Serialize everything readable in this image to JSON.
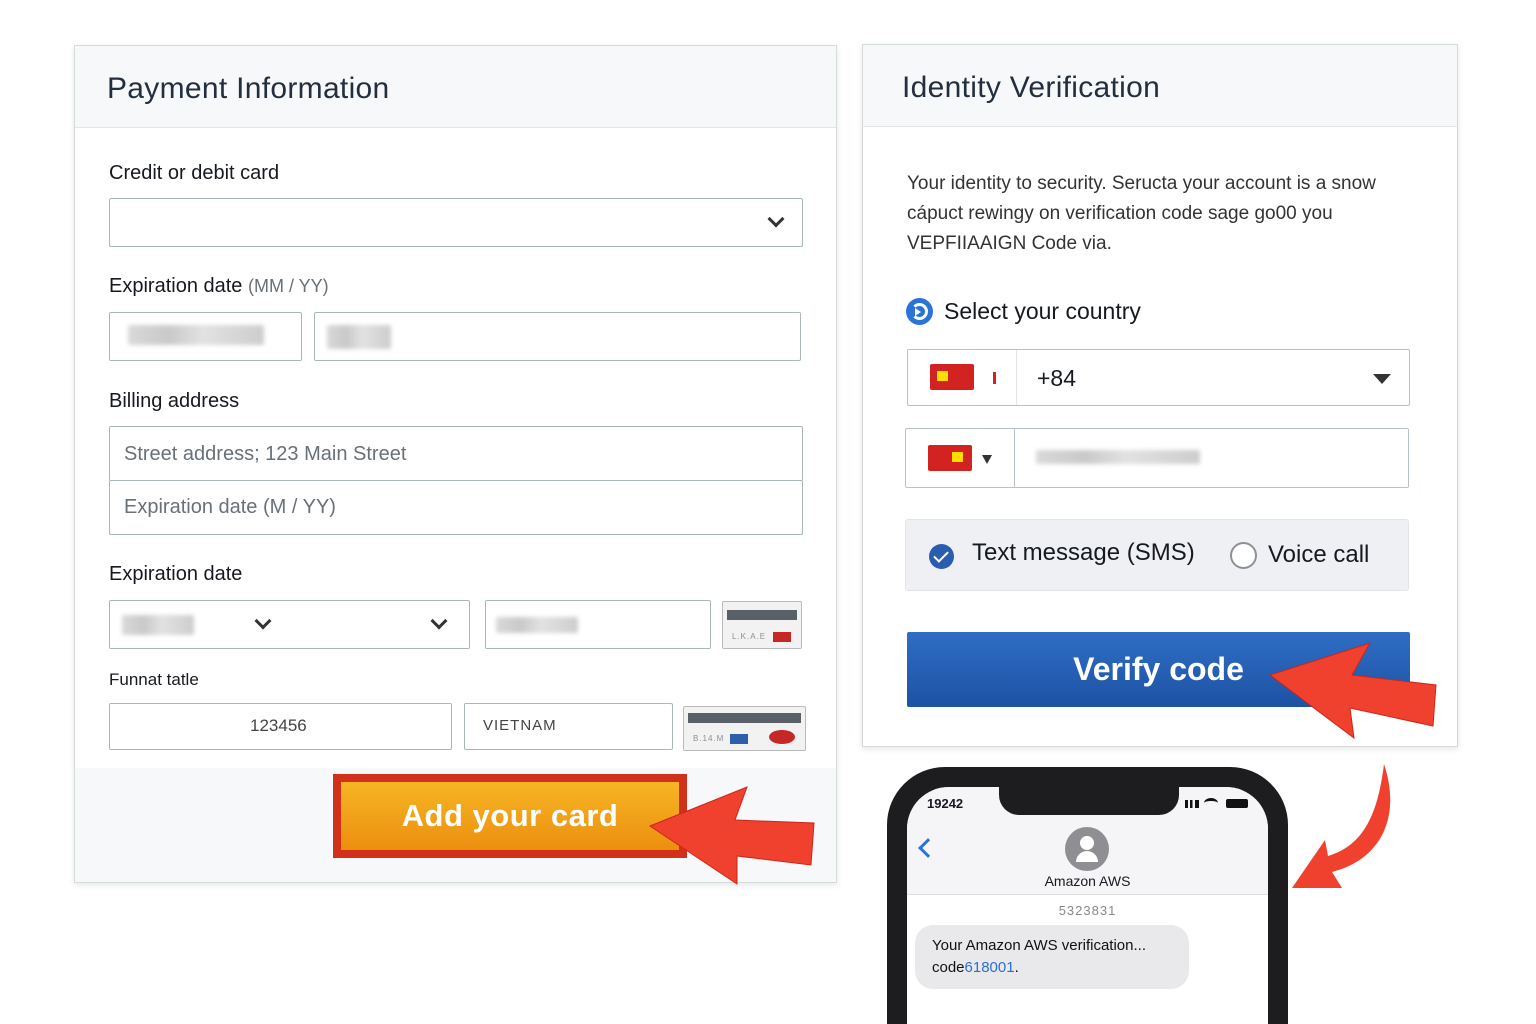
{
  "payment": {
    "title": "Payment Information",
    "card_label": "Credit or debit card",
    "exp_label": "Expiration date",
    "exp_hint": "(MM / YY)",
    "billing_label": "Billing address",
    "street_placeholder": "Street address; 123 Main Street",
    "exp_placeholder": "Expiration date (M / YY)",
    "exp_label_2": "Expiration date",
    "format_label": "Funnat tatle",
    "code_value": "123456",
    "country_value": "VIETNAM",
    "add_card_label": "Add your card"
  },
  "identity": {
    "title": "Identity Verification",
    "desc_line1": "Your identity to security. Seructa your account is a snow",
    "desc_line2": "cápuct rewingy on verification code sage go00 you",
    "desc_line3": "VEPFIIAAIGN Code via.",
    "select_country_label": "Select your country",
    "dial_code": "+84",
    "sms_label": "Text message (SMS)",
    "voice_label": "Voice call",
    "verify_label": "Verify code"
  },
  "phone": {
    "time": "19242",
    "contact": "Amazon AWS",
    "thread_id": "5323831",
    "message_line1": "Your Amazon AWS verification...",
    "message_prefix": "code",
    "message_code": "618001",
    "message_suffix": "."
  },
  "colors": {
    "add_button": "#ec8f0e",
    "add_button_border": "#d1301b",
    "verify_button": "#1d52a4",
    "arrow": "#f0412f"
  }
}
